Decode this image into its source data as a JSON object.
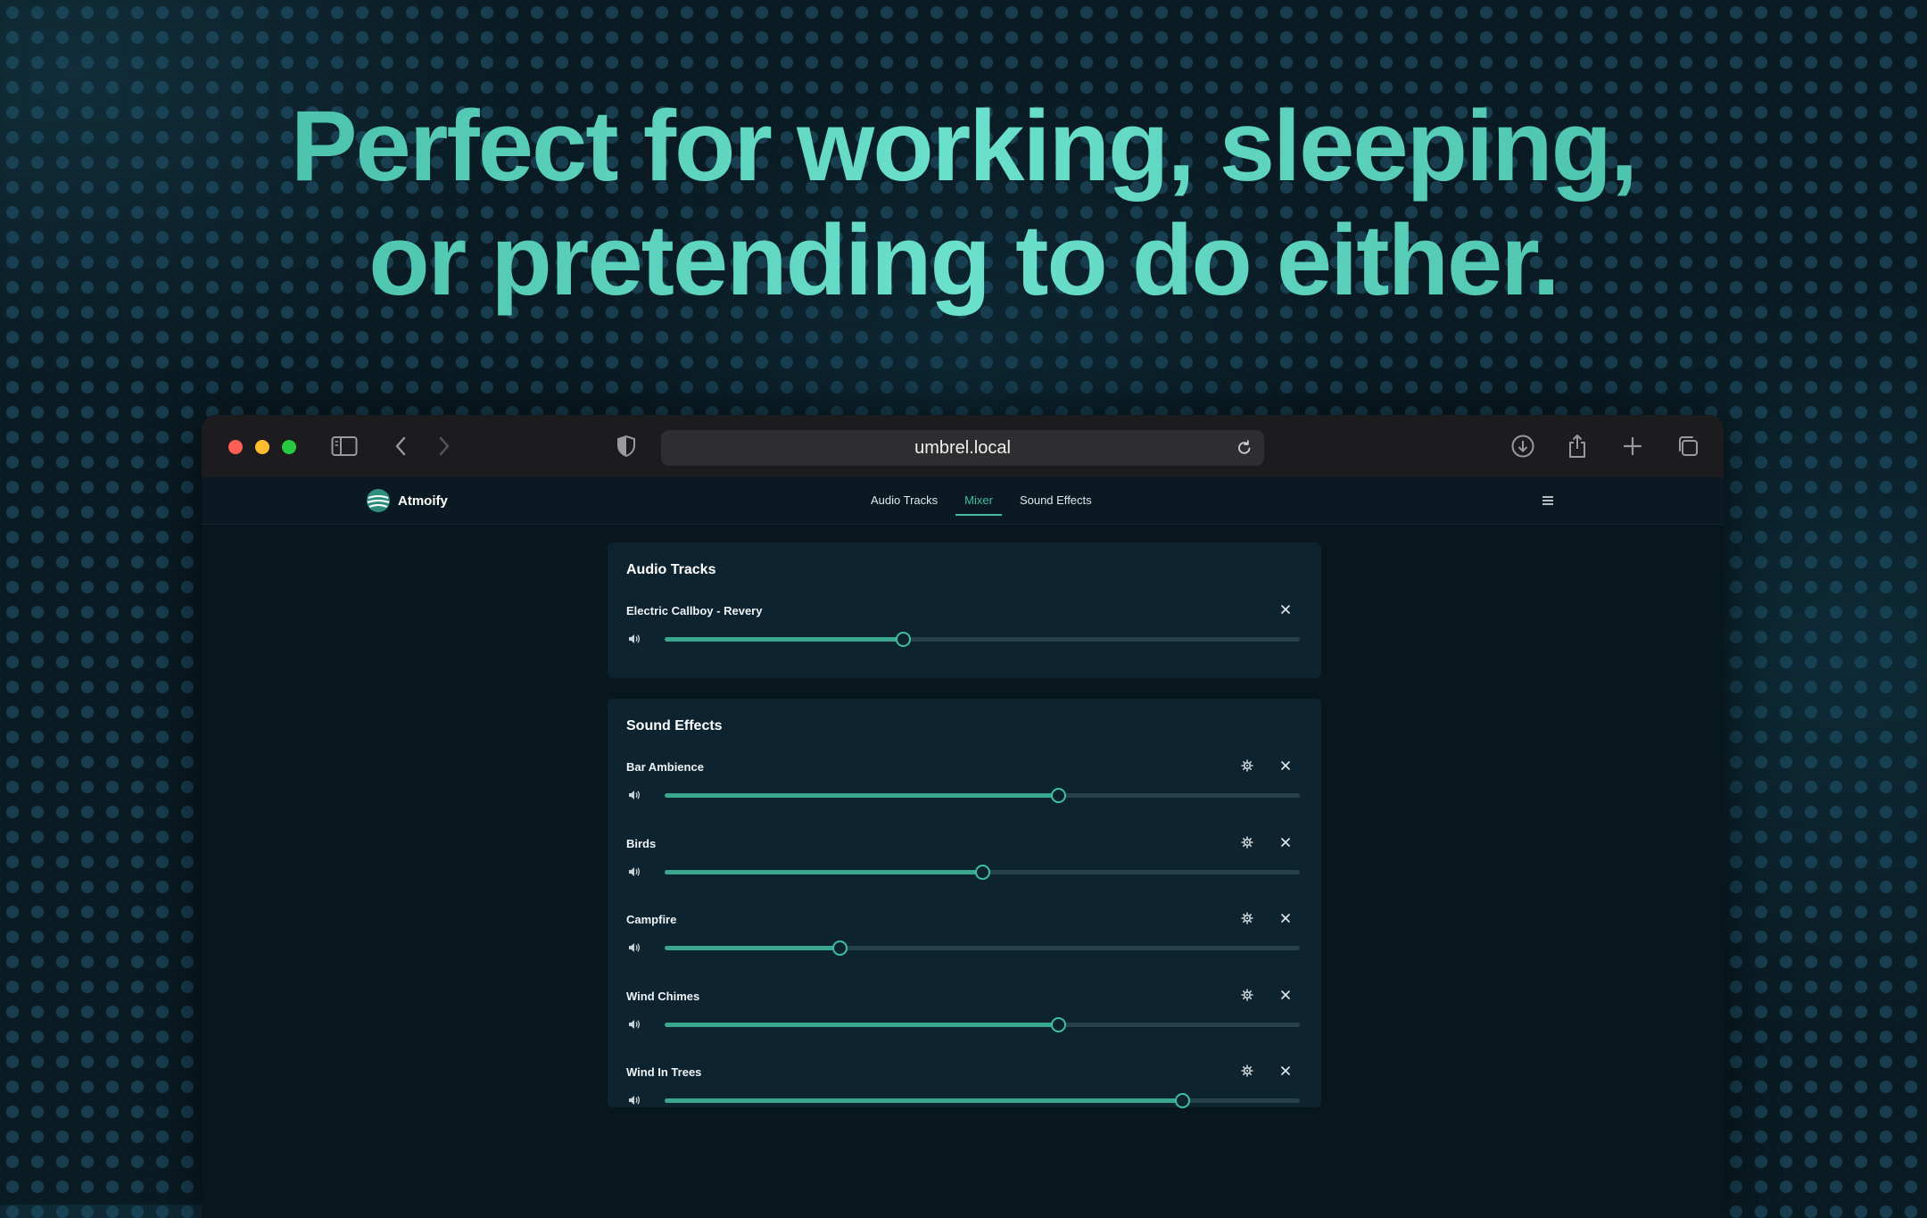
{
  "hero": {
    "line1": "Perfect for working, sleeping,",
    "line2": "or pretending to do either."
  },
  "browser": {
    "url": "umbrel.local"
  },
  "app": {
    "name": "Atmoify",
    "tabs": [
      {
        "label": "Audio Tracks",
        "active": false
      },
      {
        "label": "Mixer",
        "active": true
      },
      {
        "label": "Sound Effects",
        "active": false
      }
    ]
  },
  "audio_tracks": {
    "title": "Audio Tracks",
    "items": [
      {
        "name": "Electric Callboy - Revery",
        "volume": 0.375
      }
    ]
  },
  "sound_effects": {
    "title": "Sound Effects",
    "items": [
      {
        "name": "Bar Ambience",
        "volume": 0.62
      },
      {
        "name": "Birds",
        "volume": 0.5
      },
      {
        "name": "Campfire",
        "volume": 0.275
      },
      {
        "name": "Wind Chimes",
        "volume": 0.62
      },
      {
        "name": "Wind In Trees",
        "volume": 0.815
      }
    ]
  },
  "colors": {
    "accent": "#3fbf9f",
    "slider_fill": "#3aa88e",
    "slider_track": "#27414a",
    "card_bg": "#0e2330"
  }
}
